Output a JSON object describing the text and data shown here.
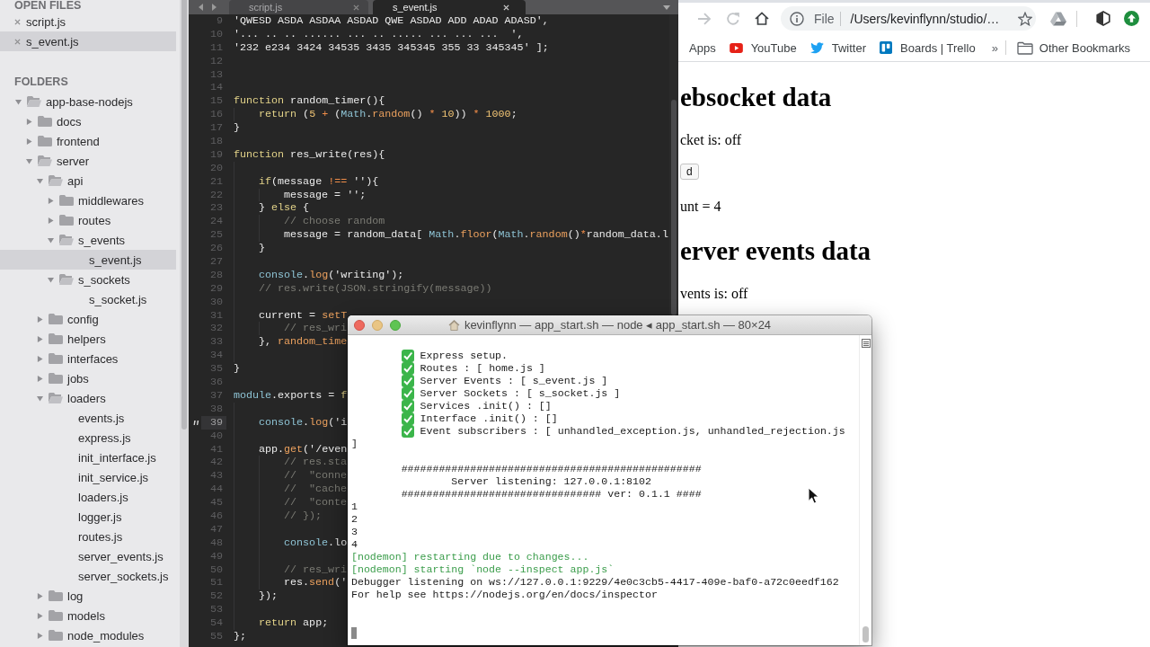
{
  "sidebar": {
    "open_files_heading": "OPEN FILES",
    "open_files": [
      {
        "label": "script.js",
        "selected": false
      },
      {
        "label": "s_event.js",
        "selected": true
      }
    ],
    "folders_heading": "FOLDERS",
    "tree": [
      {
        "label": "app-base-nodejs",
        "kind": "folder",
        "expanded": true,
        "selected": false,
        "children": [
          {
            "label": "docs",
            "kind": "folder",
            "expanded": false,
            "selected": false
          },
          {
            "label": "frontend",
            "kind": "folder",
            "expanded": false,
            "selected": false
          },
          {
            "label": "server",
            "kind": "folder",
            "expanded": true,
            "selected": false,
            "children": [
              {
                "label": "api",
                "kind": "folder",
                "expanded": true,
                "selected": false,
                "children": [
                  {
                    "label": "middlewares",
                    "kind": "folder",
                    "expanded": false,
                    "selected": false
                  },
                  {
                    "label": "routes",
                    "kind": "folder",
                    "expanded": false,
                    "selected": false
                  },
                  {
                    "label": "s_events",
                    "kind": "folder",
                    "expanded": true,
                    "selected": false,
                    "children": [
                      {
                        "label": "s_event.js",
                        "kind": "file",
                        "selected": true
                      }
                    ]
                  },
                  {
                    "label": "s_sockets",
                    "kind": "folder",
                    "expanded": true,
                    "selected": false,
                    "children": [
                      {
                        "label": "s_socket.js",
                        "kind": "file",
                        "selected": false
                      }
                    ]
                  }
                ]
              },
              {
                "label": "config",
                "kind": "folder",
                "expanded": false,
                "selected": false
              },
              {
                "label": "helpers",
                "kind": "folder",
                "expanded": false,
                "selected": false
              },
              {
                "label": "interfaces",
                "kind": "folder",
                "expanded": false,
                "selected": false
              },
              {
                "label": "jobs",
                "kind": "folder",
                "expanded": false,
                "selected": false
              },
              {
                "label": "loaders",
                "kind": "folder",
                "expanded": true,
                "selected": false,
                "children": [
                  {
                    "label": "events.js",
                    "kind": "file",
                    "selected": false
                  },
                  {
                    "label": "express.js",
                    "kind": "file",
                    "selected": false
                  },
                  {
                    "label": "init_interface.js",
                    "kind": "file",
                    "selected": false
                  },
                  {
                    "label": "init_service.js",
                    "kind": "file",
                    "selected": false
                  },
                  {
                    "label": "loaders.js",
                    "kind": "file",
                    "selected": false
                  },
                  {
                    "label": "logger.js",
                    "kind": "file",
                    "selected": false
                  },
                  {
                    "label": "routes.js",
                    "kind": "file",
                    "selected": false
                  },
                  {
                    "label": "server_events.js",
                    "kind": "file",
                    "selected": false
                  },
                  {
                    "label": "server_sockets.js",
                    "kind": "file",
                    "selected": false
                  }
                ]
              },
              {
                "label": "log",
                "kind": "folder",
                "expanded": false,
                "selected": false
              },
              {
                "label": "models",
                "kind": "folder",
                "expanded": false,
                "selected": false
              },
              {
                "label": "node_modules",
                "kind": "folder",
                "expanded": false,
                "selected": false
              }
            ]
          }
        ]
      }
    ]
  },
  "editor": {
    "tabs": [
      {
        "label": "script.js",
        "selected": false
      },
      {
        "label": "s_event.js",
        "selected": true
      }
    ],
    "lines": [
      {
        "number": "9",
        "current": false,
        "tokens": [
          {
            "kind": "plain",
            "text": "'QWESD ASDA ASDAA ASDAD QWE ASDAD ADD ADAD ADASD',"
          }
        ]
      },
      {
        "number": "10",
        "current": false,
        "tokens": [
          {
            "kind": "plain",
            "text": "'... .. .. ...... ... .. ..... ... ... ...  ',"
          }
        ]
      },
      {
        "number": "11",
        "current": false,
        "tokens": [
          {
            "kind": "plain",
            "text": "'232 e234 3424 34535 3435 345345 355 33 345345' ];"
          }
        ]
      },
      {
        "number": "12",
        "current": false
      },
      {
        "number": "13",
        "current": false
      },
      {
        "number": "14",
        "current": false
      },
      {
        "number": "15",
        "current": false,
        "tokens": [
          {
            "kind": "keyword",
            "text": "function"
          },
          {
            "kind": "plain",
            "text": " random_timer(){"
          }
        ],
        "children": [
          {
            "number": "16",
            "current": false,
            "tokens": [
              {
                "kind": "keyword",
                "text": "return"
              },
              {
                "kind": "plain",
                "text": " ("
              },
              {
                "kind": "number",
                "text": "5"
              },
              {
                "kind": "operator",
                "text": " + "
              },
              {
                "kind": "plain",
                "text": "("
              },
              {
                "kind": "builtin",
                "text": "Math"
              },
              {
                "kind": "plain",
                "text": "."
              },
              {
                "kind": "method",
                "text": "random"
              },
              {
                "kind": "plain",
                "text": "() "
              },
              {
                "kind": "operator",
                "text": "* "
              },
              {
                "kind": "number",
                "text": "10"
              },
              {
                "kind": "plain",
                "text": ")) "
              },
              {
                "kind": "operator",
                "text": "* "
              },
              {
                "kind": "number",
                "text": "1000"
              },
              {
                "kind": "plain",
                "text": ";"
              }
            ]
          }
        ]
      },
      {
        "number": "17",
        "current": false,
        "tokens": [
          {
            "kind": "plain",
            "text": "}"
          }
        ]
      },
      {
        "number": "18",
        "current": false
      },
      {
        "number": "19",
        "current": false,
        "tokens": [
          {
            "kind": "keyword",
            "text": "function"
          },
          {
            "kind": "plain",
            "text": " res_write(res){"
          }
        ],
        "children": [
          {
            "number": "20",
            "current": false
          },
          {
            "number": "21",
            "current": false,
            "tokens": [
              {
                "kind": "keyword",
                "text": "if"
              },
              {
                "kind": "plain",
                "text": "(message "
              },
              {
                "kind": "operator",
                "text": "!=="
              },
              {
                "kind": "plain",
                "text": " ''){"
              }
            ],
            "children": [
              {
                "number": "22",
                "current": false,
                "tokens": [
                  {
                    "kind": "plain",
                    "text": "message = '';"
                  }
                ]
              }
            ]
          },
          {
            "number": "23",
            "current": false,
            "tokens": [
              {
                "kind": "plain",
                "text": "} "
              },
              {
                "kind": "keyword",
                "text": "else"
              },
              {
                "kind": "plain",
                "text": " {"
              }
            ],
            "children": [
              {
                "number": "24",
                "current": false,
                "tokens": [
                  {
                    "kind": "comment",
                    "text": "// choose random"
                  }
                ]
              },
              {
                "number": "25",
                "current": false,
                "tokens": [
                  {
                    "kind": "plain",
                    "text": "message = random_data[ "
                  },
                  {
                    "kind": "builtin",
                    "text": "Math"
                  },
                  {
                    "kind": "plain",
                    "text": "."
                  },
                  {
                    "kind": "method",
                    "text": "floor"
                  },
                  {
                    "kind": "plain",
                    "text": "("
                  },
                  {
                    "kind": "builtin",
                    "text": "Math"
                  },
                  {
                    "kind": "plain",
                    "text": "."
                  },
                  {
                    "kind": "method",
                    "text": "random"
                  },
                  {
                    "kind": "plain",
                    "text": "()"
                  },
                  {
                    "kind": "operator",
                    "text": "*"
                  },
                  {
                    "kind": "plain",
                    "text": "random_data.l"
                  }
                ]
              }
            ]
          },
          {
            "number": "26",
            "current": false,
            "tokens": [
              {
                "kind": "plain",
                "text": "}"
              }
            ]
          },
          {
            "number": "27",
            "current": false
          },
          {
            "number": "28",
            "current": false,
            "tokens": [
              {
                "kind": "builtin",
                "text": "console"
              },
              {
                "kind": "plain",
                "text": "."
              },
              {
                "kind": "method",
                "text": "log"
              },
              {
                "kind": "plain",
                "text": "('writing');"
              }
            ]
          },
          {
            "number": "29",
            "current": false,
            "tokens": [
              {
                "kind": "comment",
                "text": "// res.write(JSON.stringify(message))"
              }
            ]
          },
          {
            "number": "30",
            "current": false
          },
          {
            "number": "31",
            "current": false,
            "tokens": [
              {
                "kind": "plain",
                "text": "current = "
              },
              {
                "kind": "method",
                "text": "setT"
              }
            ],
            "children": [
              {
                "number": "32",
                "current": false,
                "tokens": [
                  {
                    "kind": "comment",
                    "text": "// res_wri"
                  }
                ]
              }
            ]
          },
          {
            "number": "33",
            "current": false,
            "tokens": [
              {
                "kind": "plain",
                "text": "}, "
              },
              {
                "kind": "method",
                "text": "random_time"
              }
            ]
          },
          {
            "number": "34",
            "current": false
          }
        ]
      },
      {
        "number": "35",
        "current": false,
        "tokens": [
          {
            "kind": "plain",
            "text": "}"
          }
        ]
      },
      {
        "number": "36",
        "current": false
      },
      {
        "number": "37",
        "current": false,
        "tokens": [
          {
            "kind": "builtin",
            "text": "module"
          },
          {
            "kind": "plain",
            "text": ".exports = "
          },
          {
            "kind": "keyword",
            "text": "f"
          }
        ],
        "children": [
          {
            "number": "38",
            "current": false
          },
          {
            "number": "39",
            "current": true,
            "tokens": [
              {
                "kind": "builtin",
                "text": "console"
              },
              {
                "kind": "plain",
                "text": "."
              },
              {
                "kind": "method",
                "text": "log"
              },
              {
                "kind": "plain",
                "text": "('i"
              }
            ]
          },
          {
            "number": "40",
            "current": false
          },
          {
            "number": "41",
            "current": false,
            "tokens": [
              {
                "kind": "plain",
                "text": "app."
              },
              {
                "kind": "method",
                "text": "get"
              },
              {
                "kind": "plain",
                "text": "('/even"
              }
            ],
            "children": [
              {
                "number": "42",
                "current": false,
                "tokens": [
                  {
                    "kind": "comment",
                    "text": "// res.sta"
                  }
                ]
              },
              {
                "number": "43",
                "current": false,
                "tokens": [
                  {
                    "kind": "comment",
                    "text": "//  \"conne"
                  }
                ]
              },
              {
                "number": "44",
                "current": false,
                "tokens": [
                  {
                    "kind": "comment",
                    "text": "//  \"cache"
                  }
                ]
              },
              {
                "number": "45",
                "current": false,
                "tokens": [
                  {
                    "kind": "comment",
                    "text": "//  \"conte"
                  }
                ]
              },
              {
                "number": "46",
                "current": false,
                "tokens": [
                  {
                    "kind": "comment",
                    "text": "// });"
                  }
                ]
              },
              {
                "number": "47",
                "current": false
              },
              {
                "number": "48",
                "current": false,
                "tokens": [
                  {
                    "kind": "builtin",
                    "text": "console"
                  },
                  {
                    "kind": "plain",
                    "text": ".lo"
                  }
                ]
              },
              {
                "number": "49",
                "current": false
              },
              {
                "number": "50",
                "current": false,
                "tokens": [
                  {
                    "kind": "comment",
                    "text": "// res_wri"
                  }
                ]
              },
              {
                "number": "51",
                "current": false,
                "tokens": [
                  {
                    "kind": "plain",
                    "text": "res."
                  },
                  {
                    "kind": "method",
                    "text": "send"
                  },
                  {
                    "kind": "plain",
                    "text": "('"
                  }
                ]
              }
            ]
          },
          {
            "number": "52",
            "current": false,
            "tokens": [
              {
                "kind": "plain",
                "text": "});"
              }
            ]
          },
          {
            "number": "53",
            "current": false
          },
          {
            "number": "54",
            "current": false,
            "tokens": [
              {
                "kind": "keyword",
                "text": "return"
              },
              {
                "kind": "plain",
                "text": " app;"
              }
            ]
          }
        ]
      },
      {
        "number": "55",
        "current": false,
        "tokens": [
          {
            "kind": "plain",
            "text": "};"
          }
        ]
      }
    ]
  },
  "browser": {
    "nav_buttons": [
      {
        "kind": "forward",
        "disabled": true
      },
      {
        "kind": "reload",
        "disabled": true
      },
      {
        "kind": "home",
        "disabled": false
      }
    ],
    "address": {
      "scheme": "File",
      "url": "/Users/kevinflynn/studio/…"
    },
    "bookmarks": [
      {
        "label": "Apps"
      },
      {
        "label": "YouTube"
      },
      {
        "label": "Twitter"
      },
      {
        "label": "Boards | Trello"
      }
    ],
    "more": "»",
    "other_bookmarks": "Other Bookmarks",
    "page": [
      {
        "kind": "heading",
        "text": "ebsocket data"
      },
      {
        "kind": "paragraph",
        "text": "cket is: off"
      },
      {
        "kind": "button",
        "text": "d"
      },
      {
        "kind": "paragraph",
        "text": "unt = 4"
      },
      {
        "kind": "heading",
        "text": "erver events data"
      },
      {
        "kind": "paragraph",
        "text": "vents is: off"
      }
    ]
  },
  "terminal": {
    "title": "kevinflynn — app_start.sh — node ◂ app_start.sh — 80×24",
    "lines": [
      {
        "kind": "check",
        "text": "Express setup."
      },
      {
        "kind": "check",
        "text": "Routes : [ home.js ]"
      },
      {
        "kind": "check",
        "text": "Server Events : [ s_event.js ]"
      },
      {
        "kind": "check",
        "text": "Server Sockets : [ s_socket.js ]"
      },
      {
        "kind": "check",
        "text": "Services .init() : []"
      },
      {
        "kind": "check",
        "text": "Interface .init() : []"
      },
      {
        "kind": "check",
        "text": "Event subscribers : [ unhandled_exception.js, unhandled_rejection.js"
      },
      {
        "kind": "plain",
        "text": "]"
      },
      {
        "kind": "blank"
      },
      {
        "kind": "banner",
        "text": "################################################"
      },
      {
        "kind": "banner_title",
        "text": "Server listening: 127.0.0.1:8102"
      },
      {
        "kind": "banner",
        "text": "################################ ver: 0.1.1 ####"
      },
      {
        "kind": "plain",
        "text": "1"
      },
      {
        "kind": "plain",
        "text": "2"
      },
      {
        "kind": "plain",
        "text": "3"
      },
      {
        "kind": "plain",
        "text": "4"
      },
      {
        "kind": "nodemon",
        "text": "[nodemon] restarting due to changes..."
      },
      {
        "kind": "nodemon",
        "text": "[nodemon] starting `node --inspect app.js`"
      },
      {
        "kind": "plain",
        "text": "Debugger listening on ws://127.0.0.1:9229/4e0c3cb5-4417-409e-baf0-a72c0eedf162"
      },
      {
        "kind": "plain",
        "text": "For help see https://nodejs.org/en/docs/inspector"
      },
      {
        "kind": "blank"
      },
      {
        "kind": "blank"
      },
      {
        "kind": "cursor"
      }
    ]
  }
}
